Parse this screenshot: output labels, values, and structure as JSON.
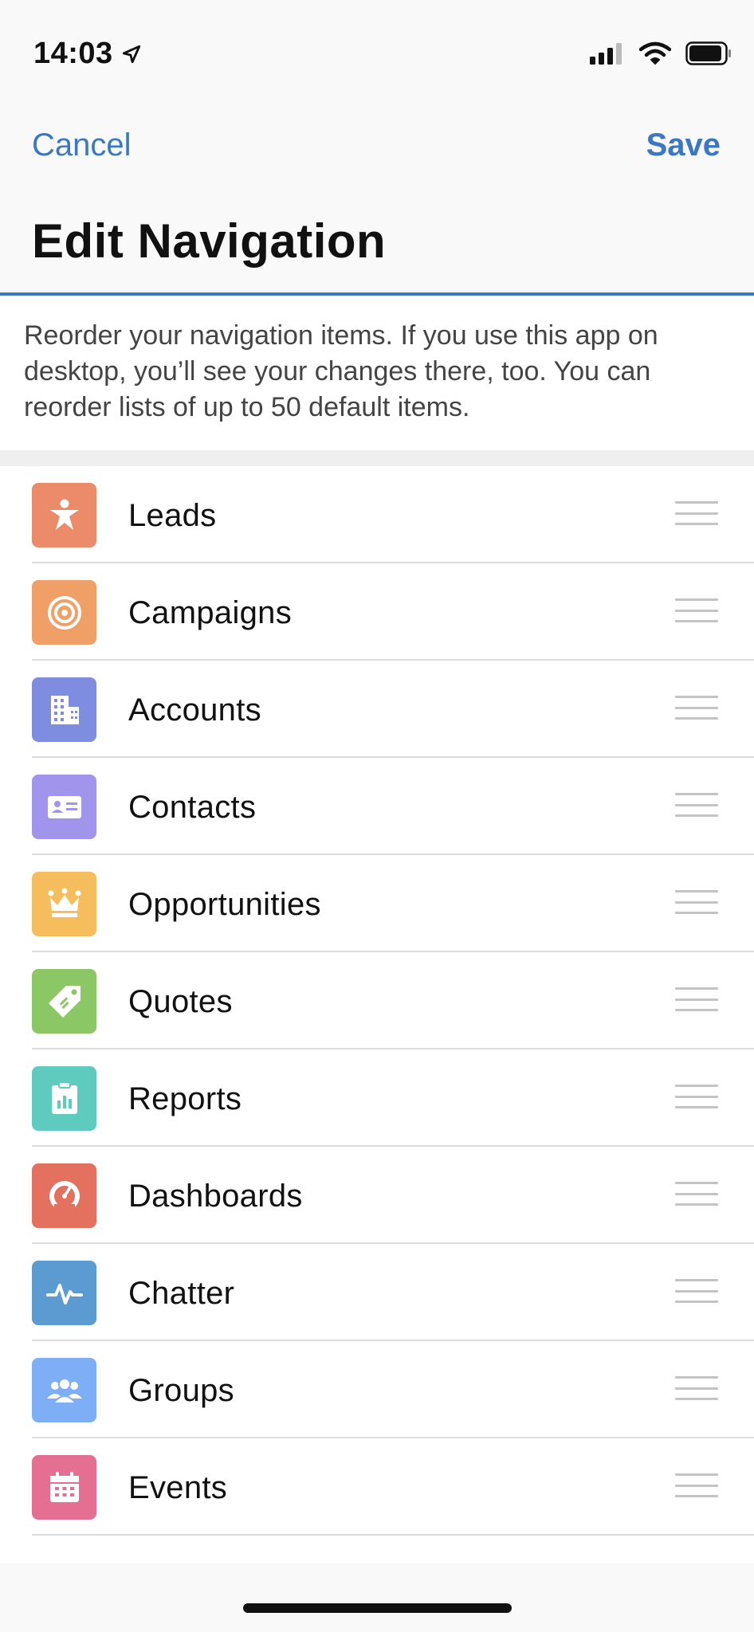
{
  "status_bar": {
    "time": "14:03"
  },
  "header": {
    "cancel_label": "Cancel",
    "save_label": "Save",
    "title": "Edit Navigation",
    "accent_color": "#3b78c4"
  },
  "description": "Reorder your navigation items. If you use this app on desktop, you’ll see your changes there, too. You can reorder lists of up to 50 default items.",
  "items": [
    {
      "label": "Leads",
      "icon": "lead-person-icon",
      "color": "#ec8b6a"
    },
    {
      "label": "Campaigns",
      "icon": "target-icon",
      "color": "#f0a066"
    },
    {
      "label": "Accounts",
      "icon": "building-icon",
      "color": "#7f8de1"
    },
    {
      "label": "Contacts",
      "icon": "contact-card-icon",
      "color": "#a094ed"
    },
    {
      "label": "Opportunities",
      "icon": "crown-icon",
      "color": "#f6bd5c"
    },
    {
      "label": "Quotes",
      "icon": "price-tag-icon",
      "color": "#8cc766"
    },
    {
      "label": "Reports",
      "icon": "report-clipboard-icon",
      "color": "#5fcbbf"
    },
    {
      "label": "Dashboards",
      "icon": "gauge-icon",
      "color": "#e4705f"
    },
    {
      "label": "Chatter",
      "icon": "pulse-icon",
      "color": "#5b9bd1"
    },
    {
      "label": "Groups",
      "icon": "group-people-icon",
      "color": "#7eaef5"
    },
    {
      "label": "Events",
      "icon": "calendar-icon",
      "color": "#e56e93"
    }
  ]
}
